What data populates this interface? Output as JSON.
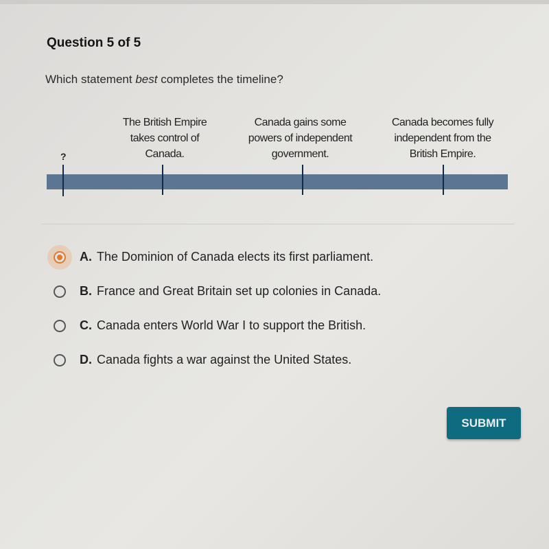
{
  "question": {
    "number_label": "Question 5 of 5",
    "prompt_before": "Which statement ",
    "prompt_emphasis": "best",
    "prompt_after": " completes the timeline?"
  },
  "timeline": {
    "events": [
      {
        "label": "?"
      },
      {
        "label_lines": [
          "The British Empire",
          "takes control of",
          "Canada."
        ]
      },
      {
        "label_lines": [
          "Canada gains some",
          "powers of independent",
          "government."
        ]
      },
      {
        "label_lines": [
          "Canada becomes fully",
          "independent from the",
          "British Empire."
        ]
      }
    ],
    "bar_color": "#5b7593",
    "tick_color": "#102a4a"
  },
  "options": [
    {
      "letter": "A.",
      "text": "The Dominion of Canada elects its first parliament.",
      "selected": true
    },
    {
      "letter": "B.",
      "text": "France and Great Britain set up colonies in Canada.",
      "selected": false
    },
    {
      "letter": "C.",
      "text": "Canada enters World War I to support the British.",
      "selected": false
    },
    {
      "letter": "D.",
      "text": "Canada fights a war against the United States.",
      "selected": false
    }
  ],
  "submit": {
    "label": "SUBMIT",
    "color": "#0f6b80"
  },
  "accent_color": "#e07a2e"
}
